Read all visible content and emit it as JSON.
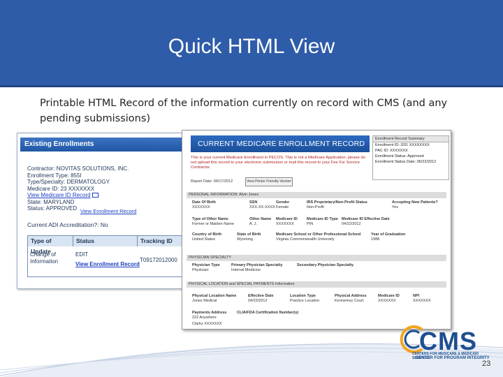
{
  "slide": {
    "title": "Quick HTML View",
    "caption": "Printable HTML Record of the information currently on record with CMS (and any pending submissions)",
    "page_number": "23"
  },
  "enrollments_panel": {
    "header": "Existing Enrollments",
    "contractor": "Contractor: NOVITAS SOLUTIONS, INC.",
    "enrollment_type": "Enrollment Type: 855I",
    "type_specialty": "Type/Specialty: DERMATOLOGY",
    "medicare_id": "Medicare ID: 23 XXXXXXX",
    "view_id_link": "View Medicare ID Record",
    "state": "State: MARYLAND",
    "status": "Status: APPROVED",
    "view_enrollment_record": "View Enrollment Record",
    "adi": "Current ADI Accreditation?: No",
    "table": {
      "headers": [
        "Type of Update",
        "Status",
        "Tracking ID"
      ],
      "row": {
        "type": "Change of Information",
        "status": "EDIT",
        "status_link": "View Enrollment Record",
        "tracking_id": "T09172012000"
      }
    }
  },
  "record_panel": {
    "banner": "CURRENT MEDICARE ENROLLMENT RECORD",
    "summary_header": "Enrollment Record Summary",
    "summary": [
      "Enrollment ID: I201 XXXXXXXX",
      "PAC ID: XXXXXXX",
      "Enrollment Status: Approved",
      "Enrollment Status Date: 06/22/2012"
    ],
    "warning": "This is your current Medicare Enrollment in PECOS. This is not a Medicare Application, please do not upload this record to your electronic submission or mail this record to your Fee For Service Contractor.",
    "report_date": "Report Date: 09/17/2012",
    "print_button": "View Printer Friendly Version",
    "personal_header": "PERSONAL INFORMATION: Alvin Jones",
    "personal_row1": [
      {
        "label": "Date Of Birth",
        "value": "XXXXXXX"
      },
      {
        "label": "SSN",
        "value": "XXX-XX-XXXX"
      },
      {
        "label": "Gender",
        "value": "Female"
      },
      {
        "label": "IRS Proprietary/Non-Profit Status",
        "value": "Non-Profit"
      },
      {
        "label": "Accepting New Patients?",
        "value": "Yes"
      }
    ],
    "personal_row2": [
      {
        "label": "Type of Other Name",
        "value": "Former or Maiden Name"
      },
      {
        "label": "Other Name",
        "value": "A. J."
      },
      {
        "label": "Medicare ID",
        "value": "XXXXXXX"
      },
      {
        "label": "Medicare ID Type",
        "value": "PIN"
      },
      {
        "label": "Medicare ID Effective Date",
        "value": "04/22/2012"
      }
    ],
    "personal_row3": [
      {
        "label": "Country of Birth",
        "value": "United States"
      },
      {
        "label": "State of Birth",
        "value": "Wyoming"
      },
      {
        "label": "Medicare School or Other Professional School",
        "value": "Virginia Commonwealth University"
      },
      {
        "label": "Year of Graduation",
        "value": "1988"
      }
    ],
    "specialty_header": "PHYSICIAN SPECIALTY",
    "specialty_row": [
      {
        "label": "Physician Type",
        "value": "Physician"
      },
      {
        "label": "Primary Physician Specialty",
        "value": "Internal Medicine"
      },
      {
        "label": "Secondary Physician Specialty",
        "value": ""
      }
    ],
    "location_header": "PHYSICAL LOCATION and SPECIAL PAYMENTS Information",
    "location_row": [
      {
        "label": "Physical Location Name",
        "value": "Jones Medical"
      },
      {
        "label": "Effective Date",
        "value": "04/22/2012"
      },
      {
        "label": "Location Type",
        "value": "Practice Location"
      },
      {
        "label": "Physical Address",
        "value": "Kennemey Court"
      },
      {
        "label": "Medicare ID",
        "value": "XXXXXXX"
      },
      {
        "label": "NPI",
        "value": "XXXXXXX"
      }
    ],
    "payments_row": [
      {
        "label": "Payments Address",
        "value": "222 Anywhere"
      },
      {
        "label": "CLIA/FDA Certification Number(s)",
        "value": ""
      }
    ],
    "payments_city": "Clarks XXXXXXX"
  },
  "logo": {
    "word": "CMS",
    "sub1": "CENTERS FOR MEDICARE & MEDICAID SERVICES",
    "sub2": "CENTER FOR PROGRAM INTEGRITY"
  },
  "colors": {
    "title_bar": "#2e5ca8",
    "banner": "#1f57a6",
    "cms_blue": "#1d4f91",
    "cms_orange": "#f3a51c",
    "warning_red": "#b01d1d"
  }
}
